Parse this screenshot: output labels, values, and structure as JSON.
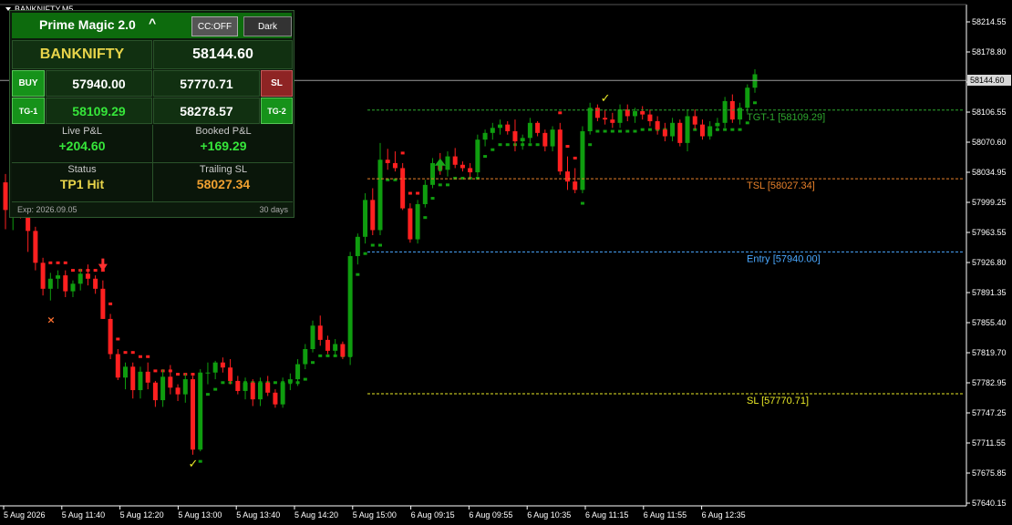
{
  "window": {
    "title": "BANKNIFTY,M5"
  },
  "panel": {
    "title": "Prime Magic 2.0",
    "collapse_label": "^",
    "cc_button": "CC:OFF",
    "dark_button": "Dark",
    "symbol": "BANKNIFTY",
    "ltp": "58144.60",
    "buy_label": "BUY",
    "buy_price": "57940.00",
    "sl_price": "57770.71",
    "sl_label": "SL",
    "tg1_label": "TG-1",
    "tg1_price": "58109.29",
    "tg2_price": "58278.57",
    "tg2_label": "TG-2",
    "live_pnl_label": "Live P&L",
    "live_pnl": "+204.60",
    "booked_pnl_label": "Booked P&L",
    "booked_pnl": "+169.29",
    "status_label": "Status",
    "status": "TP1 Hit",
    "trailing_sl_label": "Trailing SL",
    "trailing_sl": "58027.34",
    "expiry": "Exp: 2026.09.05",
    "days": "30 days"
  },
  "levels": {
    "tgt1": {
      "label": "TGT-1 [58109.29]",
      "price": 58109.29
    },
    "tsl": {
      "label": "TSL [58027.34]",
      "price": 58027.34
    },
    "entry": {
      "label": "Entry [57940.00]",
      "price": 57940.0
    },
    "sl": {
      "label": "SL [57770.71]",
      "price": 57770.71
    },
    "current": {
      "label": "58144.60",
      "price": 58144.6
    }
  },
  "price_axis": {
    "ticks": [
      "58214.55",
      "58178.80",
      "58142.30",
      "58106.55",
      "58070.60",
      "58034.95",
      "57999.25",
      "57963.55",
      "57926.80",
      "57891.35",
      "57855.40",
      "57819.70",
      "57782.95",
      "57747.25",
      "57711.55",
      "57675.85",
      "57640.15"
    ]
  },
  "time_axis": {
    "ticks": [
      "5 Aug 2026",
      "5 Aug 11:40",
      "5 Aug 12:20",
      "5 Aug 13:00",
      "5 Aug 13:40",
      "5 Aug 14:20",
      "5 Aug 15:00",
      "6 Aug 09:15",
      "6 Aug 09:55",
      "6 Aug 10:35",
      "6 Aug 11:15",
      "6 Aug 11:55",
      "6 Aug 12:35"
    ]
  },
  "colors": {
    "bull": "#0f9d0f",
    "bear": "#ff2020",
    "tgt": "#2ea82e",
    "tsl": "#e8812a",
    "entry": "#4aa8ff",
    "sl": "#e8e826"
  },
  "chart_data": {
    "type": "candlestick",
    "symbol": "BANKNIFTY",
    "timeframe": "M5",
    "y_range": [
      57640.15,
      58214.55
    ],
    "candles": [
      [
        58023,
        58033,
        57967,
        57990
      ],
      [
        57990,
        58010,
        57966,
        58004
      ],
      [
        58004,
        58007,
        57980,
        57995
      ],
      [
        57995,
        58000,
        57940,
        57965
      ],
      [
        57965,
        57970,
        57918,
        57927
      ],
      [
        57927,
        57933,
        57888,
        57896
      ],
      [
        57896,
        57915,
        57882,
        57908
      ],
      [
        57908,
        57918,
        57896,
        57912
      ],
      [
        57912,
        57918,
        57886,
        57893
      ],
      [
        57893,
        57906,
        57886,
        57902
      ],
      [
        57902,
        57920,
        57894,
        57914
      ],
      [
        57914,
        57925,
        57900,
        57908
      ],
      [
        57908,
        57912,
        57890,
        57896
      ],
      [
        57896,
        57906,
        57860,
        57860
      ],
      [
        57860,
        57866,
        57812,
        57818
      ],
      [
        57818,
        57824,
        57787,
        57790
      ],
      [
        57790,
        57808,
        57776,
        57803
      ],
      [
        57803,
        57808,
        57765,
        57775
      ],
      [
        57775,
        57803,
        57765,
        57797
      ],
      [
        57797,
        57808,
        57776,
        57784
      ],
      [
        57784,
        57786,
        57755,
        57763
      ],
      [
        57763,
        57800,
        57755,
        57791
      ],
      [
        57791,
        57805,
        57770,
        57778
      ],
      [
        57778,
        57782,
        57762,
        57770
      ],
      [
        57770,
        57795,
        57760,
        57788
      ],
      [
        57788,
        57792,
        57698,
        57704
      ],
      [
        57704,
        57800,
        57702,
        57796
      ],
      [
        57796,
        57808,
        57782,
        57796
      ],
      [
        57796,
        57810,
        57788,
        57808
      ],
      [
        57808,
        57814,
        57796,
        57802
      ],
      [
        57802,
        57812,
        57782,
        57786
      ],
      [
        57786,
        57792,
        57770,
        57774
      ],
      [
        57774,
        57790,
        57764,
        57784
      ],
      [
        57784,
        57788,
        57756,
        57764
      ],
      [
        57764,
        57790,
        57756,
        57784
      ],
      [
        57784,
        57792,
        57768,
        57772
      ],
      [
        57772,
        57776,
        57754,
        57758
      ],
      [
        57758,
        57790,
        57754,
        57784
      ],
      [
        57784,
        57795,
        57775,
        57788
      ],
      [
        57788,
        57812,
        57780,
        57806
      ],
      [
        57806,
        57830,
        57800,
        57824
      ],
      [
        57824,
        57858,
        57820,
        57852
      ],
      [
        57852,
        57864,
        57828,
        57835
      ],
      [
        57835,
        57840,
        57818,
        57822
      ],
      [
        57822,
        57836,
        57816,
        57830
      ],
      [
        57830,
        57833,
        57812,
        57815
      ],
      [
        57815,
        57940,
        57805,
        57935
      ],
      [
        57935,
        57962,
        57925,
        57958
      ],
      [
        57958,
        58010,
        57950,
        58002
      ],
      [
        58002,
        58016,
        57960,
        57966
      ],
      [
        57966,
        58070,
        57960,
        58050
      ],
      [
        58050,
        58063,
        58038,
        58046
      ],
      [
        58046,
        58060,
        58036,
        58040
      ],
      [
        58040,
        58046,
        57990,
        57992
      ],
      [
        57992,
        57998,
        57951,
        57955
      ],
      [
        57955,
        58002,
        57950,
        57997
      ],
      [
        57997,
        58026,
        57993,
        58020
      ],
      [
        58020,
        58052,
        58016,
        58046
      ],
      [
        58046,
        58058,
        58032,
        58038
      ],
      [
        58038,
        58060,
        58030,
        58054
      ],
      [
        58054,
        58064,
        58040,
        58044
      ],
      [
        58044,
        58048,
        58036,
        58040
      ],
      [
        58040,
        58046,
        58028,
        58035
      ],
      [
        58035,
        58080,
        58030,
        58074
      ],
      [
        58074,
        58086,
        58066,
        58082
      ],
      [
        58082,
        58094,
        58074,
        58088
      ],
      [
        58088,
        58098,
        58080,
        58092
      ],
      [
        58092,
        58096,
        58080,
        58084
      ],
      [
        58084,
        58098,
        58060,
        58072
      ],
      [
        58072,
        58080,
        58062,
        58076
      ],
      [
        58076,
        58100,
        58070,
        58094
      ],
      [
        58094,
        58096,
        58078,
        58082
      ],
      [
        58082,
        58086,
        58060,
        58066
      ],
      [
        58066,
        58090,
        58060,
        58086
      ],
      [
        58086,
        58094,
        58032,
        58036
      ],
      [
        58036,
        58054,
        58014,
        58024
      ],
      [
        58024,
        58040,
        58010,
        58014
      ],
      [
        58014,
        58090,
        58010,
        58084
      ],
      [
        58084,
        58118,
        58080,
        58112
      ],
      [
        58112,
        58116,
        58096,
        58100
      ],
      [
        58100,
        58110,
        58092,
        58098
      ],
      [
        58098,
        58106,
        58088,
        58094
      ],
      [
        58094,
        58116,
        58088,
        58110
      ],
      [
        58110,
        58116,
        58096,
        58102
      ],
      [
        58102,
        58112,
        58094,
        58108
      ],
      [
        58108,
        58114,
        58098,
        58104
      ],
      [
        58104,
        58110,
        58090,
        58096
      ],
      [
        58096,
        58102,
        58080,
        58086
      ],
      [
        58086,
        58094,
        58072,
        58078
      ],
      [
        58078,
        58100,
        58072,
        58094
      ],
      [
        58094,
        58098,
        58066,
        58070
      ],
      [
        58070,
        58110,
        58060,
        58102
      ],
      [
        58102,
        58110,
        58086,
        58092
      ],
      [
        58092,
        58098,
        58074,
        58078
      ],
      [
        58078,
        58096,
        58074,
        58090
      ],
      [
        58090,
        58100,
        58084,
        58094
      ],
      [
        58094,
        58125,
        58088,
        58120
      ],
      [
        58120,
        58128,
        58094,
        58098
      ],
      [
        58098,
        58118,
        58092,
        58112
      ],
      [
        58112,
        58140,
        58106,
        58136
      ],
      [
        58136,
        58158,
        58130,
        58152
      ]
    ],
    "trend_line_note": "trailing dots follow price",
    "markers": [
      {
        "type": "down-arrow",
        "candle": 13
      },
      {
        "type": "x-mark",
        "candle": 6
      },
      {
        "type": "check",
        "candle": 25
      },
      {
        "type": "up-arrow",
        "candle": 58
      },
      {
        "type": "check",
        "candle": 80
      }
    ]
  }
}
